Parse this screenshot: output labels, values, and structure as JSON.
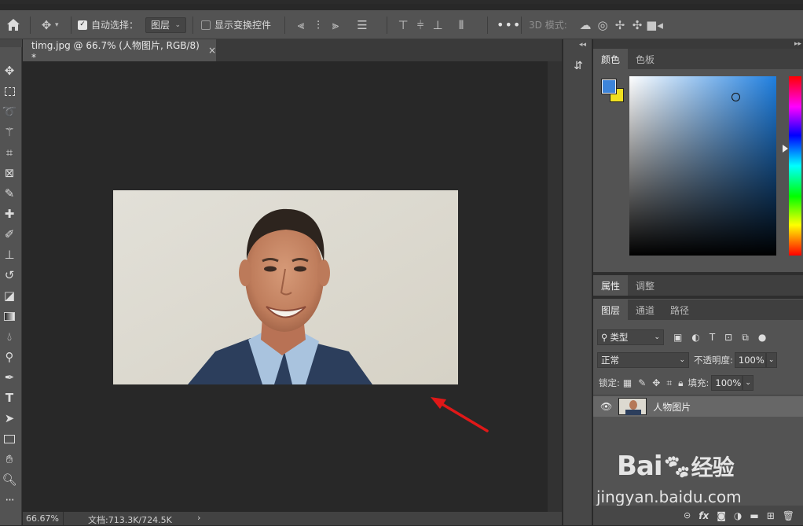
{
  "options_bar": {
    "auto_select_label": "自动选择：",
    "auto_select_value": "图层",
    "show_transform_label": "显示变换控件",
    "mode_3d_label": "3D 模式:"
  },
  "document": {
    "tab_title": "timg.jpg @ 66.7% (人物图片, RGB/8) *",
    "close_glyph": "×"
  },
  "status": {
    "zoom": "66.67%",
    "doc_size": "文档:713.3K/724.5K",
    "arrow": "›"
  },
  "color_panel": {
    "tabs": [
      "颜色",
      "色板"
    ],
    "foreground_color": "#3d84d9",
    "background_color": "#f0e020"
  },
  "properties_panel": {
    "tabs": [
      "属性",
      "调整"
    ]
  },
  "layers_panel": {
    "tabs": [
      "图层",
      "通道",
      "路径"
    ],
    "filter_kind": "类型",
    "blend_mode": "正常",
    "opacity_label": "不透明度:",
    "opacity_value": "100%",
    "lock_label": "锁定:",
    "fill_label": "填充:",
    "fill_value": "100%",
    "layers": [
      {
        "name": "人物图片",
        "visible": true
      }
    ],
    "bottom_icons": [
      "link-icon",
      "fx-icon",
      "mask-icon",
      "adjustment-icon",
      "group-icon",
      "new-layer-icon",
      "trash-icon"
    ],
    "fx_label": "fx"
  },
  "watermark": {
    "brand": "Bai",
    "brand_cn": "经验",
    "url": "jingyan.baidu.com"
  },
  "colors": {
    "annotation_arrow": "#e01818",
    "panel": "#535353",
    "canvas_bg": "#282828"
  }
}
